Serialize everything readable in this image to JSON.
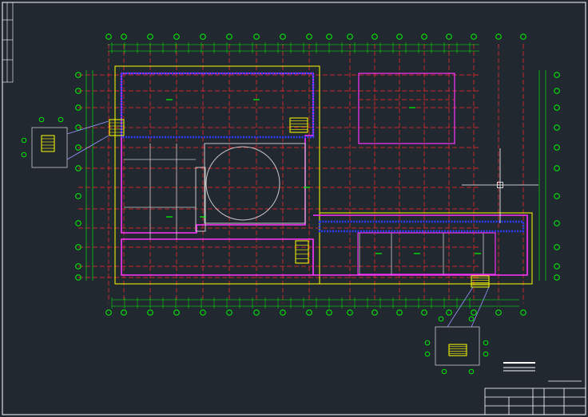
{
  "drawing": {
    "background": "#212830",
    "colors": {
      "axis": "#ff2a2a",
      "grid_bubble": "#00ff00",
      "dimension": "#00ff00",
      "wall_outer": "#ff33ff",
      "wall_inner": "#c8c8c8",
      "hatch": "#2b3bff",
      "outline": "#ffff00",
      "frame": "#ffffff",
      "stair": "#ffff00",
      "leader": "#9a9aff"
    }
  },
  "title_block": {
    "rows": [
      "",
      "",
      ""
    ]
  },
  "icons": {
    "crosshair": "crosshair-icon"
  }
}
